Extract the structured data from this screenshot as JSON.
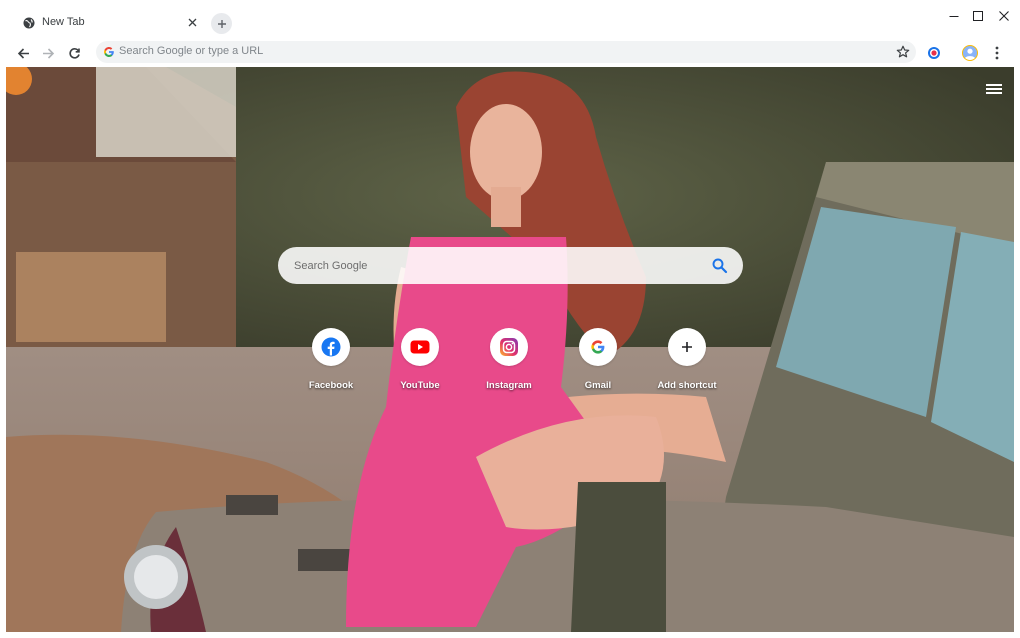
{
  "browser": {
    "tab": {
      "title": "New Tab"
    },
    "omnibox": {
      "placeholder": "Search Google or type a URL"
    }
  },
  "newtab": {
    "search": {
      "placeholder": "Search Google"
    },
    "shortcuts": [
      {
        "label": "Facebook",
        "icon": "facebook-icon"
      },
      {
        "label": "YouTube",
        "icon": "youtube-icon"
      },
      {
        "label": "Instagram",
        "icon": "instagram-icon"
      },
      {
        "label": "Gmail",
        "icon": "google-icon"
      },
      {
        "label": "Add shortcut",
        "icon": "plus-icon"
      }
    ]
  },
  "colors": {
    "accent_blue": "#1a73e8",
    "facebook_blue": "#1877f2",
    "youtube_red": "#ff0000",
    "instagram_pink": "#d6249f"
  }
}
